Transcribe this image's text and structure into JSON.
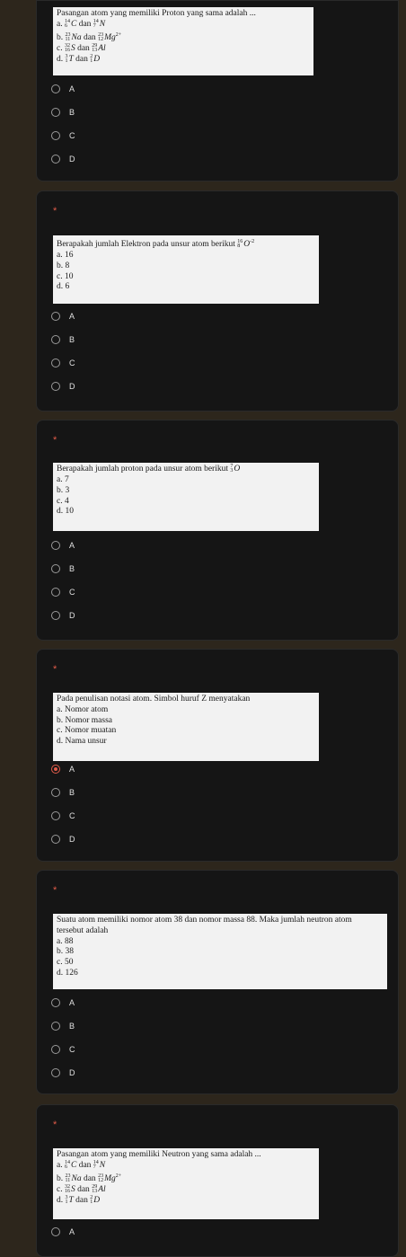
{
  "questions": [
    {
      "text": "Pasangan atom yang memiliki Proton yang sama adalah ...",
      "choices": [
        {
          "letter": "a.",
          "a_mass": "14",
          "a_num": "6",
          "a_sym": "C",
          "mid": "dan",
          "b_mass": "14",
          "b_num": "7",
          "b_sym": "N",
          "b_charge": ""
        },
        {
          "letter": "b.",
          "a_mass": "23",
          "a_num": "11",
          "a_sym": "Na",
          "mid": "dan",
          "b_mass": "23",
          "b_num": "12",
          "b_sym": "Mg",
          "b_charge": "2+"
        },
        {
          "letter": "c.",
          "a_mass": "32",
          "a_num": "16",
          "a_sym": "S",
          "mid": "dan",
          "b_mass": "29",
          "b_num": "13",
          "b_sym": "Al",
          "b_charge": ""
        },
        {
          "letter": "d.",
          "a_mass": "3",
          "a_num": "1",
          "a_sym": "T",
          "mid": "dan",
          "b_mass": "2",
          "b_num": "1",
          "b_sym": "D",
          "b_charge": ""
        }
      ],
      "options": [
        "A",
        "B",
        "C",
        "D"
      ],
      "required_mark": ""
    },
    {
      "required_mark": "*",
      "text": "Berapakah jumlah Elektron  pada unsur atom berikut",
      "formula": {
        "mass": "16",
        "num": "8",
        "sym": "O",
        "charge": "-2"
      },
      "choices_plain": [
        "a.  16",
        "b.  8",
        "c.  10",
        "d.  6"
      ],
      "options": [
        "A",
        "B",
        "C",
        "D"
      ]
    },
    {
      "required_mark": "*",
      "text": "Berapakah jumlah proton  pada unsur atom berikut",
      "formula": {
        "mass": "7",
        "num": "3",
        "sym": "O",
        "charge": ""
      },
      "choices_plain": [
        "a.  7",
        "b.  3",
        "c.  4",
        "d.  10"
      ],
      "options": [
        "A",
        "B",
        "C",
        "D"
      ]
    },
    {
      "required_mark": "*",
      "text": "Pada penulisan notasi atom. Simbol huruf Z menyatakan",
      "choices_plain": [
        "a.  Nomor atom",
        "b.  Nomor massa",
        "c.  Nomor muatan",
        "d.  Nama unsur"
      ],
      "options": [
        "A",
        "B",
        "C",
        "D"
      ],
      "selected": "A"
    },
    {
      "required_mark": "*",
      "text": "Suatu atom memiliki nomor atom 38 dan nomor massa 88. Maka jumlah neutron atom",
      "text2": "tersebut adalah",
      "choices_plain": [
        "a.  88",
        "b.  38",
        "c.  50",
        "d.  126"
      ],
      "options": [
        "A",
        "B",
        "C",
        "D"
      ]
    },
    {
      "required_mark": "*",
      "text": "Pasangan atom yang memiliki Neutron yang sama adalah ...",
      "choices": [
        {
          "letter": "a.",
          "a_mass": "14",
          "a_num": "6",
          "a_sym": "C",
          "mid": "dan",
          "b_mass": "14",
          "b_num": "7",
          "b_sym": "N",
          "b_charge": ""
        },
        {
          "letter": "b.",
          "a_mass": "23",
          "a_num": "11",
          "a_sym": "Na",
          "mid": "dan",
          "b_mass": "23",
          "b_num": "12",
          "b_sym": "Mg",
          "b_charge": "2+"
        },
        {
          "letter": "c.",
          "a_mass": "32",
          "a_num": "16",
          "a_sym": "S",
          "mid": "dan",
          "b_mass": "29",
          "b_num": "13",
          "b_sym": "Al",
          "b_charge": ""
        },
        {
          "letter": "d.",
          "a_mass": "3",
          "a_num": "1",
          "a_sym": "T",
          "mid": "dan",
          "b_mass": "2",
          "b_num": "1",
          "b_sym": "D",
          "b_charge": ""
        }
      ],
      "options": [
        "A"
      ]
    }
  ]
}
